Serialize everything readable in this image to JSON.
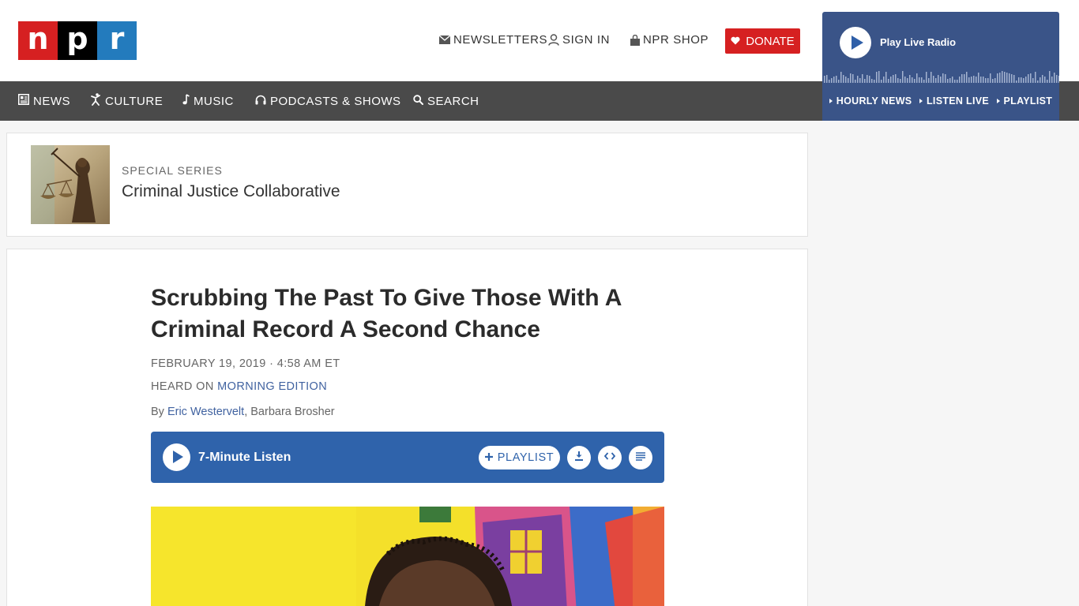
{
  "brand": {
    "logo_letters": [
      "n",
      "p",
      "r"
    ],
    "colors": {
      "n": "#d62021",
      "p": "#000000",
      "r": "#237bbd"
    }
  },
  "header": {
    "newsletters": "NEWSLETTERS",
    "sign_in": "SIGN IN",
    "shop": "NPR SHOP",
    "donate": "DONATE"
  },
  "nav": {
    "news": "NEWS",
    "culture": "CULTURE",
    "music": "MUSIC",
    "podcasts": "PODCASTS & SHOWS",
    "search": "SEARCH"
  },
  "radio": {
    "play_label": "Play Live Radio",
    "links": [
      "HOURLY NEWS",
      "LISTEN LIVE",
      "PLAYLIST"
    ]
  },
  "series": {
    "kicker": "SPECIAL SERIES",
    "title": "Criminal Justice Collaborative"
  },
  "article": {
    "headline": "Scrubbing The Past To Give Those With A Criminal Record A Second Chance",
    "date": "FEBRUARY 19, 2019 · 4:58 AM ET",
    "heard_on_prefix": "HEARD ON ",
    "heard_on_show": "MORNING EDITION",
    "by_prefix": "By ",
    "author1": "Eric Westervelt",
    "author_sep": ", ",
    "author2": "Barbara Brosher"
  },
  "player": {
    "listen_label": "7-Minute Listen",
    "playlist_label": "PLAYLIST",
    "icons": [
      "download-icon",
      "embed-icon",
      "transcript-icon"
    ]
  },
  "icons": {
    "newsletters": "envelope-icon",
    "sign_in": "user-icon",
    "shop": "bag-icon",
    "donate": "heart-icon",
    "news": "newspaper-icon",
    "culture": "dancer-icon",
    "music": "music-note-icon",
    "podcasts": "headphones-icon",
    "search": "search-icon"
  }
}
